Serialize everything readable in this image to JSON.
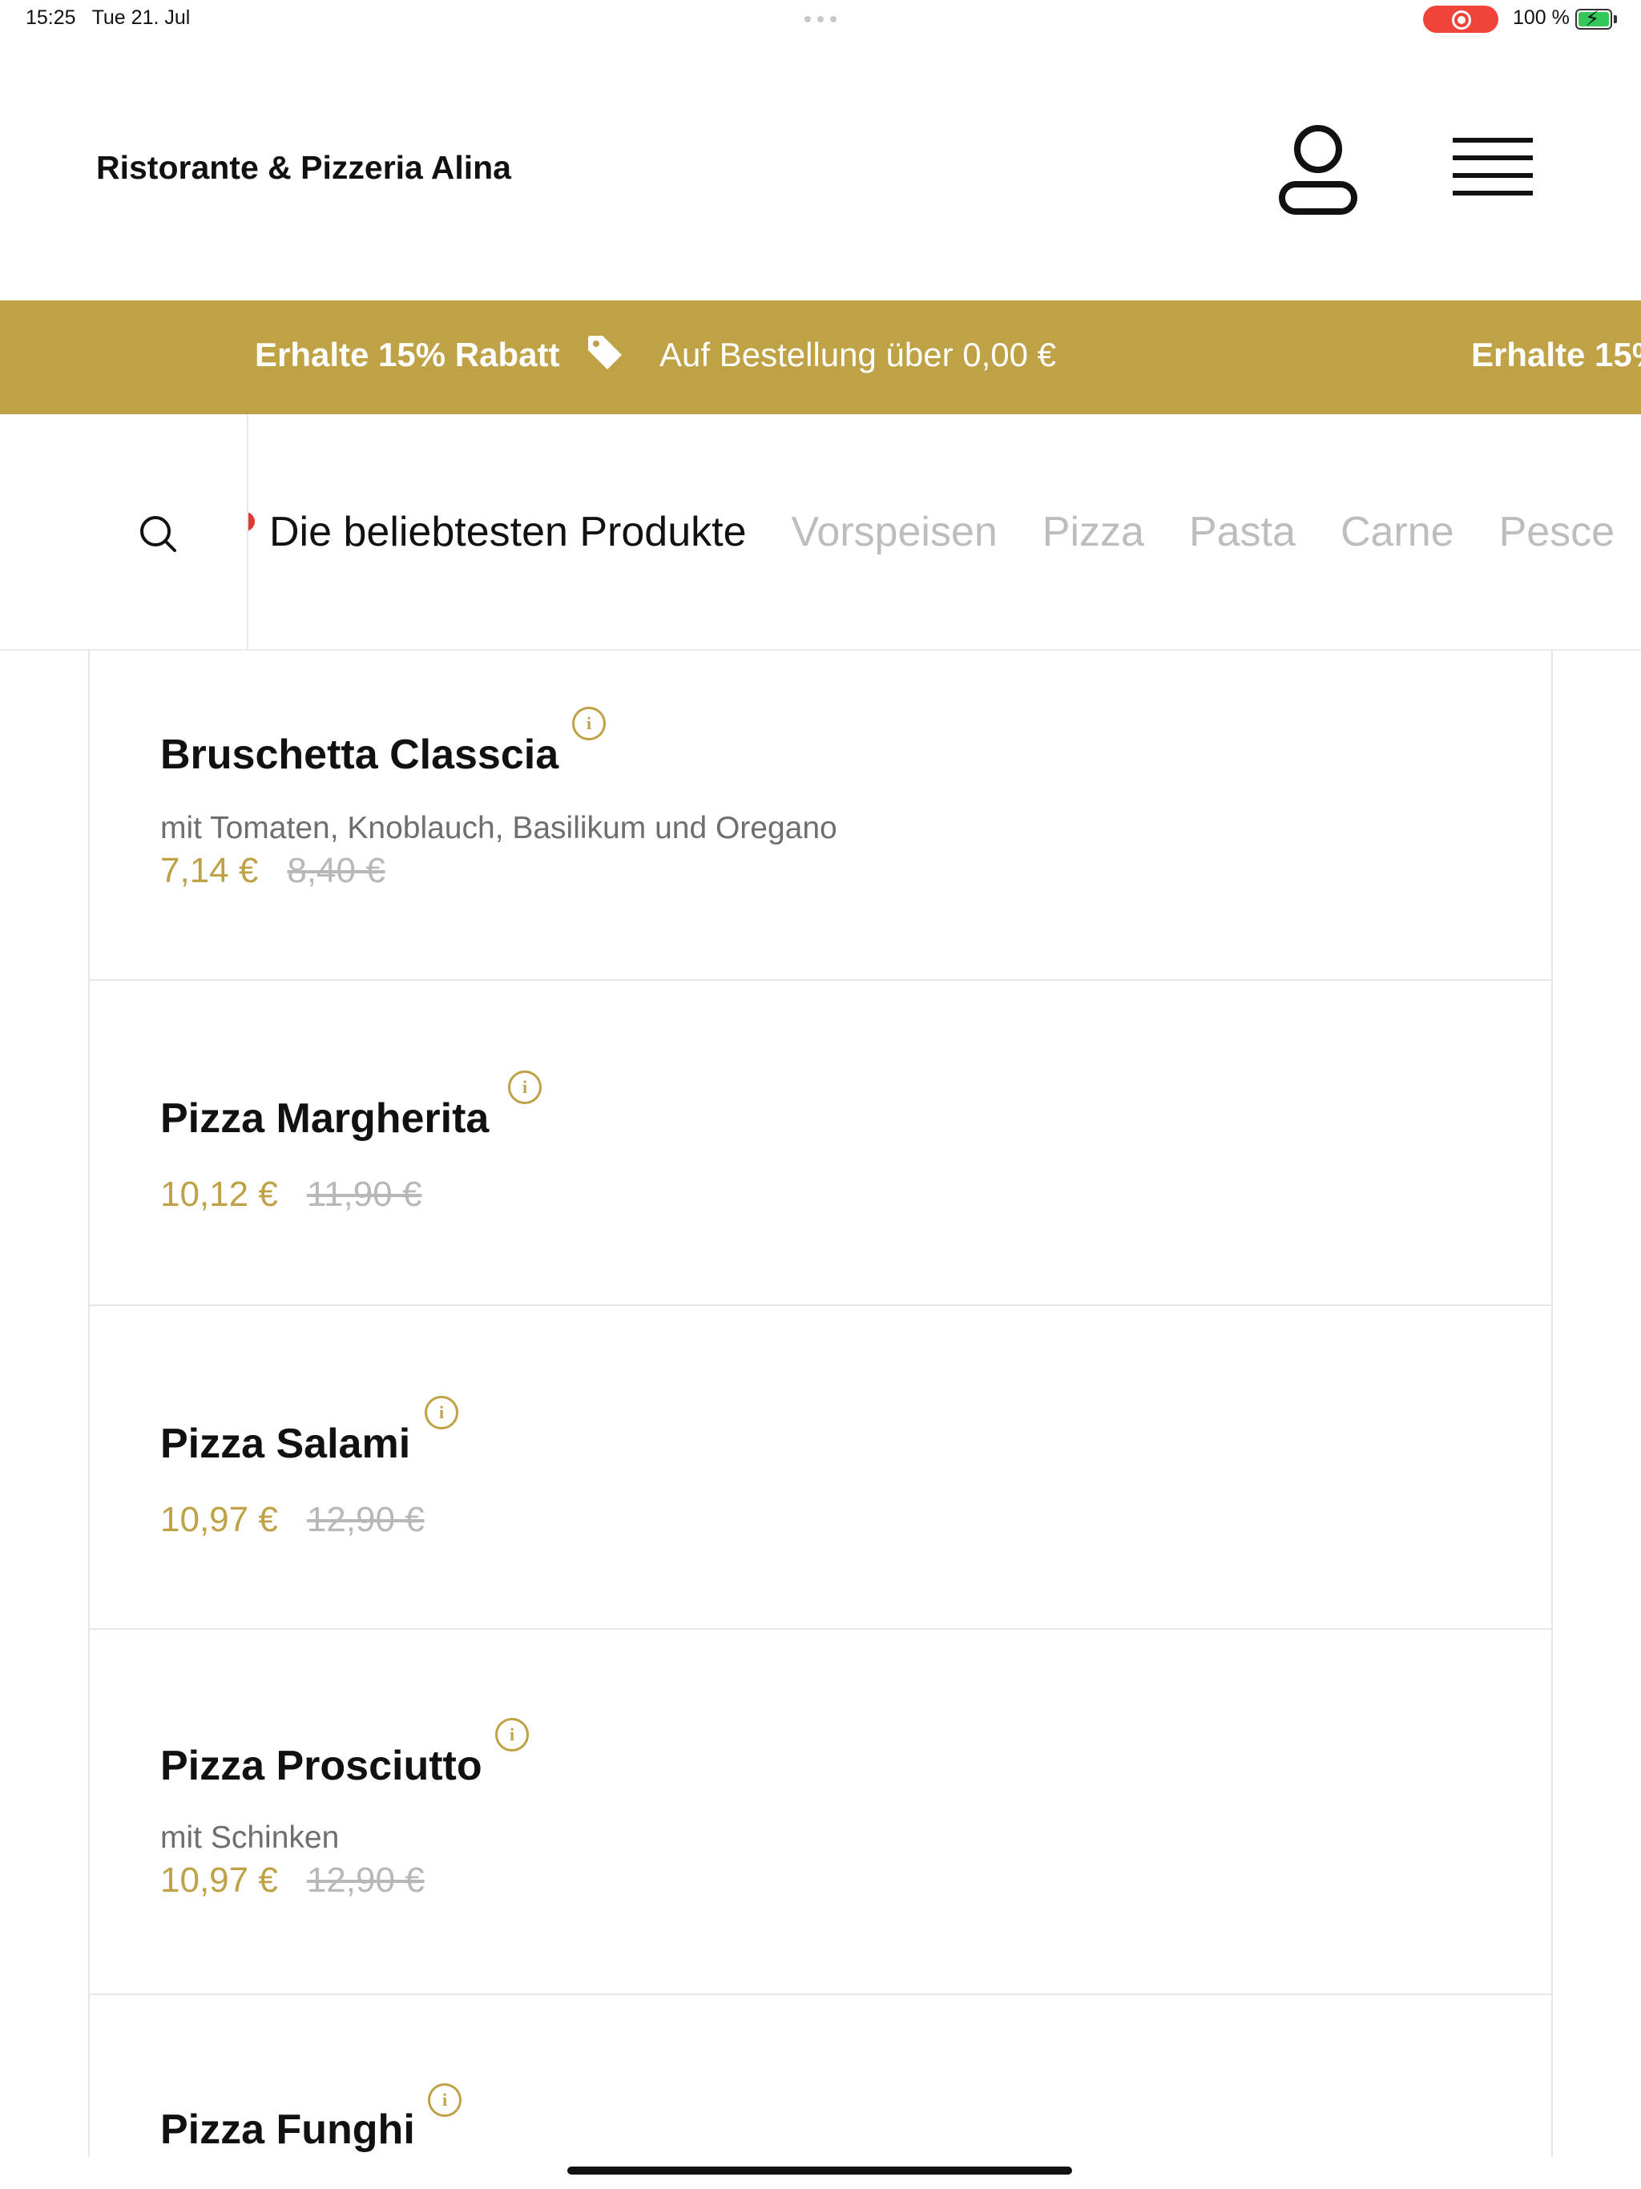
{
  "status_bar": {
    "time": "15:25",
    "date": "Tue 21. Jul",
    "battery": "100 %",
    "recording_color": "#f0433a",
    "battery_color": "#34c759"
  },
  "header": {
    "brand": "Ristorante & Pizzeria Alina",
    "account_icon": "user-icon",
    "menu_icon": "hamburger-menu-icon"
  },
  "promo": {
    "title": "Erhalte 15% Rabatt",
    "subtitle": "Auf Bestellung über 0,00 €",
    "title_repeat": "Erhalte 15%",
    "tag_icon": "tag-icon",
    "background_color": "#bfa146"
  },
  "nav": {
    "search_icon": "search-icon",
    "categories": [
      {
        "label": "Die beliebtesten Produkte",
        "active": true
      },
      {
        "label": "Vorspeisen",
        "active": false
      },
      {
        "label": "Pizza",
        "active": false
      },
      {
        "label": "Pasta",
        "active": false
      },
      {
        "label": "Carne",
        "active": false
      },
      {
        "label": "Pesce",
        "active": false
      }
    ]
  },
  "products": [
    {
      "name": "Bruschetta Classcia",
      "description": "mit Tomaten, Knoblauch, Basilikum und Oregano",
      "price": "7,14 €",
      "old_price": "8,40 €"
    },
    {
      "name": "Pizza Margherita",
      "description": "",
      "price": "10,12 €",
      "old_price": "11,90 €"
    },
    {
      "name": "Pizza Salami",
      "description": "",
      "price": "10,97 €",
      "old_price": "12,90 €"
    },
    {
      "name": "Pizza Prosciutto",
      "description": "mit Schinken",
      "price": "10,97 €",
      "old_price": "12,90 €"
    },
    {
      "name": "Pizza Funghi",
      "description": "",
      "price": "",
      "old_price": ""
    }
  ],
  "info_icon_glyph": "i",
  "accent_color": "#bfa146"
}
